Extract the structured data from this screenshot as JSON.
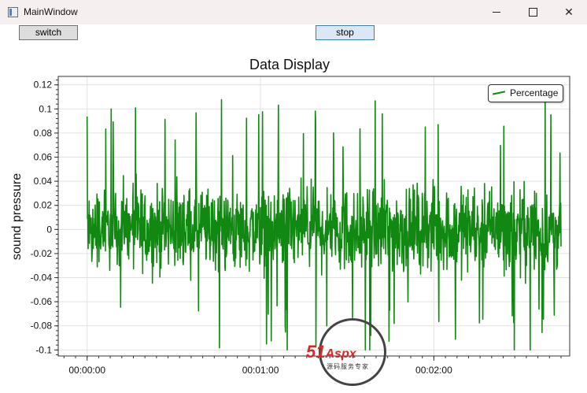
{
  "window": {
    "title": "MainWindow",
    "minimize_label": "",
    "maximize_label": "",
    "close_label": "✕"
  },
  "toolbar": {
    "switch_label": "switch",
    "stop_label": "stop"
  },
  "watermark": {
    "brand": "51",
    "brand_rest": "Aspx",
    "tagline": "源码服务专家"
  },
  "chart_data": {
    "type": "line",
    "title": "Data Display",
    "ylabel": "sound pressure",
    "xlabel": "",
    "xlim_seconds": [
      -10,
      167
    ],
    "ylim": [
      -0.105,
      0.127
    ],
    "x_tick_labels": [
      "00:00:00",
      "00:01:00",
      "00:02:00"
    ],
    "x_tick_seconds": [
      0,
      60,
      120
    ],
    "y_tick_labels": [
      "0.12",
      "0.1",
      "0.08",
      "0.06",
      "0.04",
      "0.02",
      "0",
      "-0.02",
      "-0.04",
      "-0.06",
      "-0.08",
      "-0.1"
    ],
    "y_ticks": [
      0.12,
      0.1,
      0.08,
      0.06,
      0.04,
      0.02,
      0,
      -0.02,
      -0.04,
      -0.06,
      -0.08,
      -0.1
    ],
    "grid": true,
    "legend_position": "top-right",
    "series": [
      {
        "name": "Percentage",
        "color": "#118811",
        "x_start_seconds": 0,
        "x_end_seconds": 164,
        "peak_positive": 0.12,
        "peak_negative": -0.1,
        "typical_amplitude": 0.05
      }
    ]
  }
}
